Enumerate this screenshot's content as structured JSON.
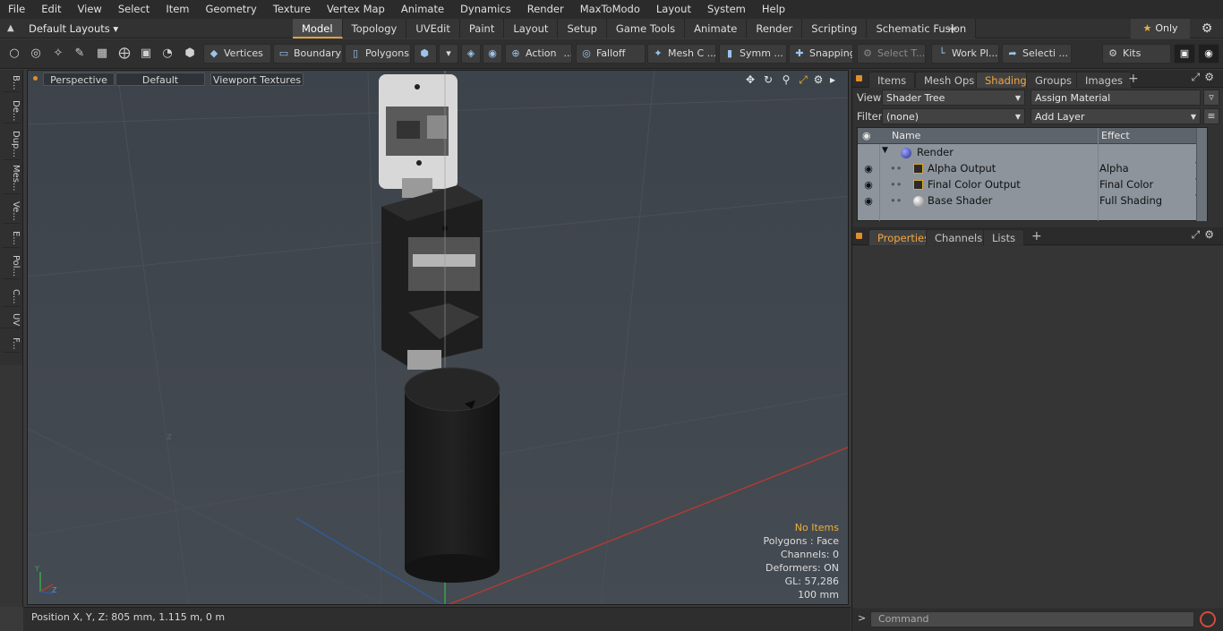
{
  "menu": [
    "File",
    "Edit",
    "View",
    "Select",
    "Item",
    "Geometry",
    "Texture",
    "Vertex Map",
    "Animate",
    "Dynamics",
    "Render",
    "MaxToModo",
    "Layout",
    "System",
    "Help"
  ],
  "layout": {
    "dropdown": "Default Layouts ▾",
    "tabs": [
      "Model",
      "Topology",
      "UVEdit",
      "Paint",
      "Layout",
      "Setup",
      "Game Tools",
      "Animate",
      "Render",
      "Scripting",
      "Schematic Fusion"
    ],
    "active_tab": "Model",
    "only_label": "Only",
    "plus": "+"
  },
  "toolbar": {
    "vertices": "Vertices",
    "boundary": "Boundary",
    "polygons": "Polygons",
    "action": "Action",
    "action_more": "...",
    "falloff": "Falloff",
    "mesh": "Mesh C ...",
    "symm": "Symm ...",
    "snapping": "Snapping",
    "select_t": "Select T...",
    "workplane": "Work Pl...",
    "selecti": "Selecti ...",
    "kits": "Kits"
  },
  "left_tabs": [
    "B...",
    "De...",
    "Dup...",
    "Mes...",
    "Ve...",
    "E...",
    "Pol...",
    "C...",
    "UV",
    "F..."
  ],
  "viewport": {
    "projection": "Perspective",
    "style": "Default",
    "textures": "Viewport Textures",
    "info": {
      "no_items": "No Items",
      "polygons": "Polygons : Face",
      "channels": "Channels: 0",
      "deformers": "Deformers: ON",
      "gl": "GL: 57,286",
      "scale": "100 mm"
    }
  },
  "status": {
    "position": "Position X, Y, Z:   805 mm, 1.115 m, 0 m"
  },
  "top_panel": {
    "tabs": [
      "Items",
      "Mesh Ops",
      "Shading",
      "Groups",
      "Images"
    ],
    "active_tab": "Shading",
    "plus": "+",
    "view_label": "View",
    "view_value": "Shader Tree",
    "assign_material": "Assign Material",
    "filter_label": "Filter",
    "filter_value": "(none)",
    "add_layer": "Add Layer",
    "columns": {
      "name": "Name",
      "effect": "Effect"
    },
    "rows": [
      {
        "name": "Render",
        "effect": ""
      },
      {
        "name": "Alpha Output",
        "effect": "Alpha"
      },
      {
        "name": "Final Color Output",
        "effect": "Final Color"
      },
      {
        "name": "Base Shader",
        "effect": "Full Shading"
      }
    ]
  },
  "bottom_panel": {
    "tabs": [
      "Properties",
      "Channels",
      "Lists"
    ],
    "active_tab": "Properties",
    "plus": "+"
  },
  "command": {
    "prompt": ">",
    "placeholder": "Command"
  }
}
